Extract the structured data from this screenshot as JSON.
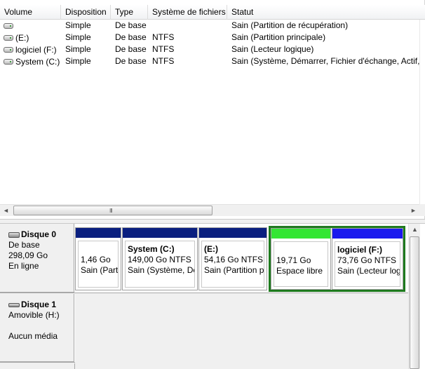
{
  "volume_table": {
    "columns": [
      "Volume",
      "Disposition",
      "Type",
      "Système de fichiers",
      "Statut"
    ],
    "rows": [
      {
        "volume": "",
        "disposition": "Simple",
        "type": "De base",
        "fs": "",
        "status": "Sain (Partition de récupération)"
      },
      {
        "volume": "(E:)",
        "disposition": "Simple",
        "type": "De base",
        "fs": "NTFS",
        "status": "Sain (Partition principale)"
      },
      {
        "volume": "logiciel (F:)",
        "disposition": "Simple",
        "type": "De base",
        "fs": "NTFS",
        "status": "Sain (Lecteur logique)"
      },
      {
        "volume": "System (C:)",
        "disposition": "Simple",
        "type": "De base",
        "fs": "NTFS",
        "status": "Sain (Système, Démarrer, Fichier d'échange, Actif, V"
      }
    ]
  },
  "hscroll": {
    "left_arrow": "◄",
    "right_arrow": "►",
    "grip": "III"
  },
  "vscroll": {
    "up_arrow": "▲"
  },
  "disk0": {
    "name": "Disque 0",
    "type": "De base",
    "size": "298,09 Go",
    "state": "En ligne",
    "partitions": [
      {
        "title": "",
        "size": "1,46 Go",
        "status": "Sain (Part",
        "bar_color": "#0a1f7f"
      },
      {
        "title": "System  (C:)",
        "size": "149,00 Go NTFS",
        "status": "Sain (Système, Dé",
        "bar_color": "#0a1f7f"
      },
      {
        "title": "(E:)",
        "size": "54,16 Go NTFS",
        "status": "Sain (Partition p",
        "bar_color": "#0a1f7f"
      },
      {
        "title": "",
        "size": "19,71 Go",
        "status": "Espace libre",
        "bar_color": "#33e633"
      },
      {
        "title": "logiciel  (F:)",
        "size": "73,76 Go NTFS",
        "status": "Sain (Lecteur log",
        "bar_color": "#1a1aee"
      }
    ]
  },
  "disk1": {
    "name": "Disque 1",
    "type": "Amovible (H:)",
    "media": "Aucun média"
  },
  "colors": {
    "primary_partition": "#0a1f7f",
    "free_space": "#33e633",
    "logical_drive": "#1a1aee",
    "selection_border": "#1e7a1e"
  }
}
